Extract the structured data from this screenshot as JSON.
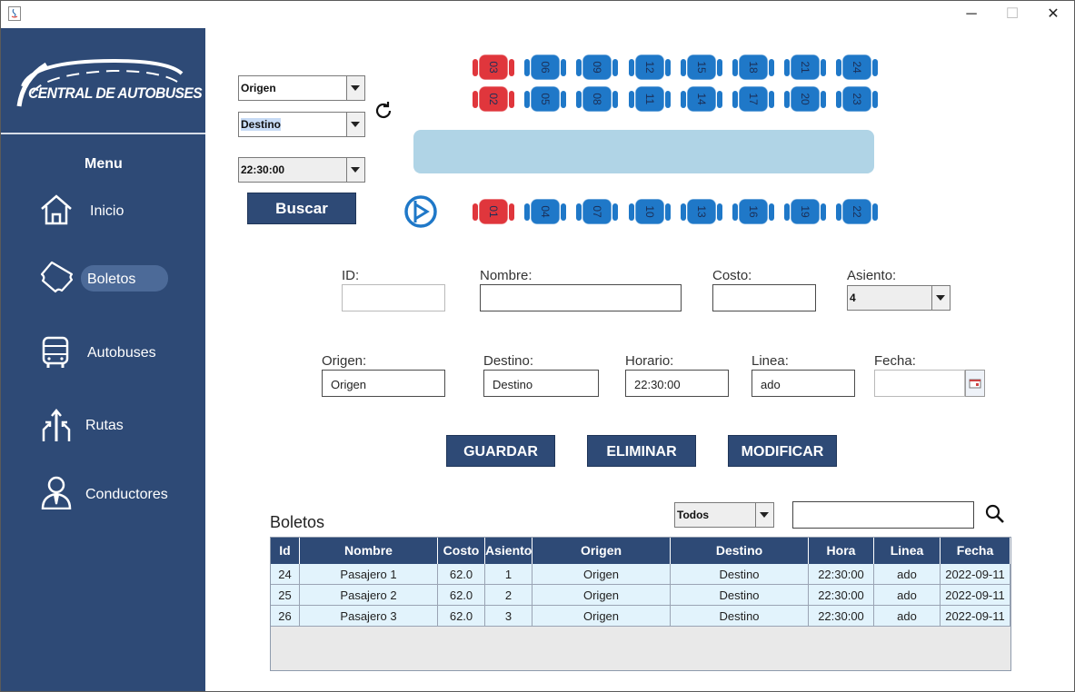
{
  "app": {
    "window_controls": {
      "minimize": "─",
      "maximize": "☐",
      "close": "✕"
    }
  },
  "sidebar": {
    "logo_text": "CENTRAL DE AUTOBUSES",
    "menu_title": "Menu",
    "items": [
      {
        "label": "Inicio",
        "icon": "home-icon"
      },
      {
        "label": "Boletos",
        "icon": "ticket-icon",
        "active": true
      },
      {
        "label": "Autobuses",
        "icon": "bus-icon"
      },
      {
        "label": "Rutas",
        "icon": "routes-icon"
      },
      {
        "label": "Conductores",
        "icon": "driver-icon"
      }
    ],
    "colors": {
      "background": "#2e4a76",
      "active_pill": "#4c6a98"
    }
  },
  "search_panel": {
    "origen_combo": "Origen",
    "destino_combo": "Destino",
    "horario_combo": "22:30:00",
    "buscar_button": "Buscar"
  },
  "seats": {
    "top_row": [
      "03",
      "06",
      "09",
      "12",
      "15",
      "18",
      "21",
      "24"
    ],
    "middle_row": [
      "02",
      "05",
      "08",
      "11",
      "14",
      "17",
      "20",
      "23"
    ],
    "bottom_row": [
      "01",
      "04",
      "07",
      "10",
      "13",
      "16",
      "19",
      "22"
    ],
    "occupied": [
      "01",
      "02",
      "03"
    ],
    "colors": {
      "available": "#1f78c8",
      "occupied": "#e0363c",
      "aisle": "#b0d4e6"
    }
  },
  "form": {
    "id": {
      "label": "ID:",
      "value": ""
    },
    "nombre": {
      "label": "Nombre:",
      "value": ""
    },
    "costo": {
      "label": "Costo:",
      "value": ""
    },
    "asiento": {
      "label": "Asiento:",
      "value": "4"
    },
    "origen": {
      "label": "Origen:",
      "value": "Origen"
    },
    "destino": {
      "label": "Destino:",
      "value": "Destino"
    },
    "horario": {
      "label": "Horario:",
      "value": "22:30:00"
    },
    "linea": {
      "label": "Linea:",
      "value": "ado"
    },
    "fecha": {
      "label": "Fecha:",
      "value": ""
    }
  },
  "actions": {
    "guardar": "GUARDAR",
    "eliminar": "ELIMINAR",
    "modificar": "MODIFICAR"
  },
  "table": {
    "title": "Boletos",
    "filter_combo": "Todos",
    "search_value": "",
    "columns": [
      "Id",
      "Nombre",
      "Costo",
      "Asiento",
      "Origen",
      "Destino",
      "Hora",
      "Linea",
      "Fecha"
    ],
    "rows": [
      [
        "24",
        "Pasajero 1",
        "62.0",
        "1",
        "Origen",
        "Destino",
        "22:30:00",
        "ado",
        "2022-09-11"
      ],
      [
        "25",
        "Pasajero 2",
        "62.0",
        "2",
        "Origen",
        "Destino",
        "22:30:00",
        "ado",
        "2022-09-11"
      ],
      [
        "26",
        "Pasajero 3",
        "62.0",
        "3",
        "Origen",
        "Destino",
        "22:30:00",
        "ado",
        "2022-09-11"
      ]
    ],
    "colors": {
      "header": "#2e4a76",
      "row": "#e2f3fc"
    }
  }
}
